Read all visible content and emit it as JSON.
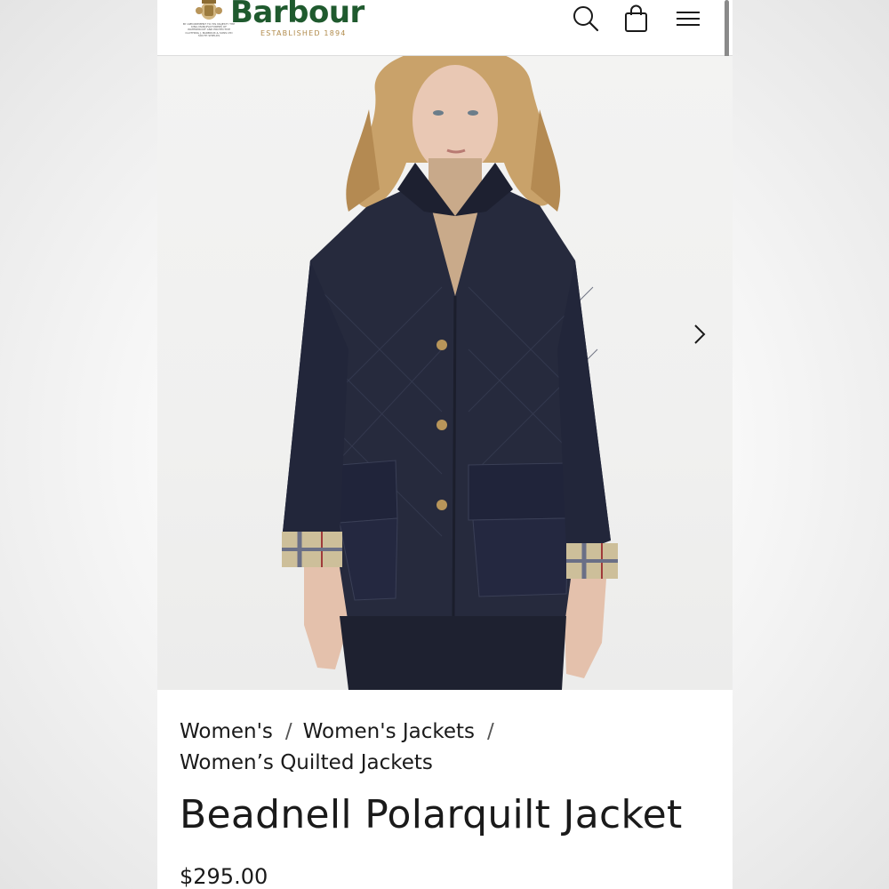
{
  "header": {
    "brand": "Barbour",
    "established": "ESTABLISHED 1894",
    "crest_motto": "BY APPOINTMENT TO HIS MAJESTY THE KING MANUFACTURERS OF WATERPROOF AND PROTECTIVE CLOTHING J. BARBOUR & SONS LTD SOUTH SHIELDS",
    "icons": [
      "search-icon",
      "shopping-bag-icon",
      "menu-icon"
    ]
  },
  "colors": {
    "brand_green": "#1f5a2e",
    "established_gold": "#b08a4a",
    "text": "#1a1a1a",
    "jacket_navy": "#262a3d"
  },
  "gallery": {
    "next_icon": "chevron-right-icon"
  },
  "breadcrumb": {
    "items": [
      "Women's",
      "Women's Jackets",
      "Women’s Quilted Jackets"
    ],
    "separator": "/"
  },
  "product": {
    "title": "Beadnell Polarquilt Jacket",
    "price": "$295.00"
  }
}
